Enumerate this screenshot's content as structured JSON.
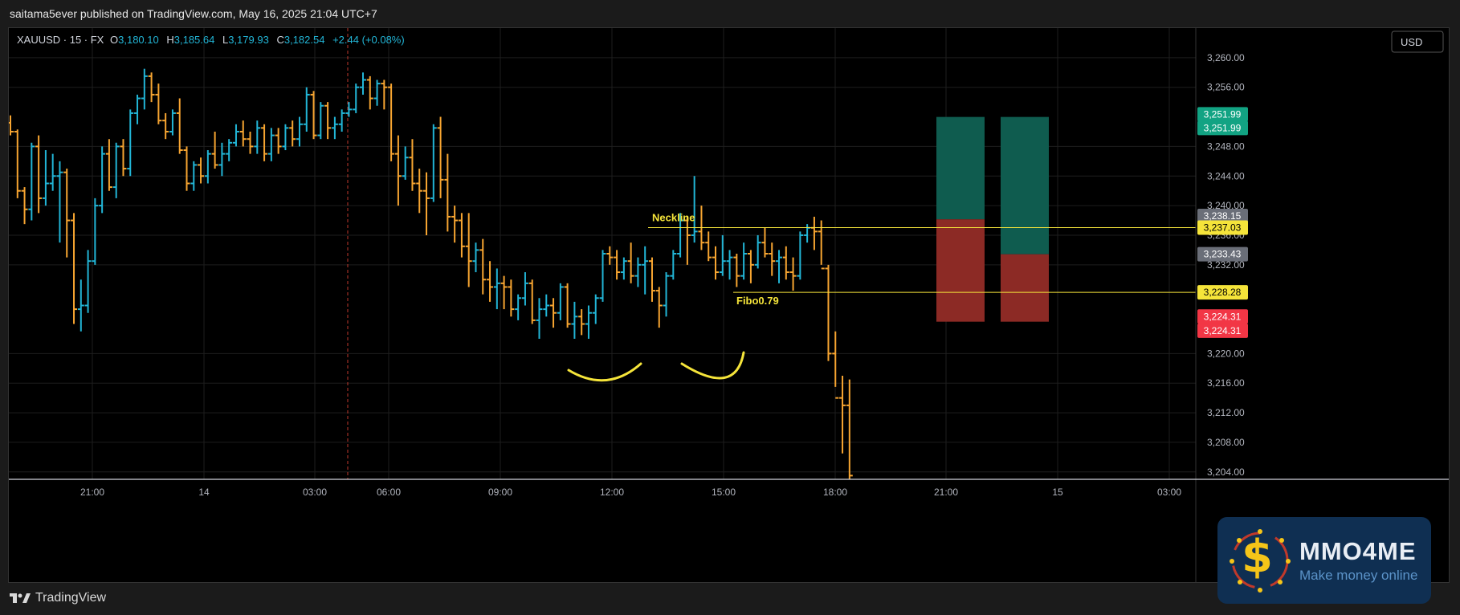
{
  "header": {
    "publisher_text": "saitama5ever published on TradingView.com, May 16, 2025 21:04 UTC+7"
  },
  "footer": {
    "logo_text": "TradingView"
  },
  "badge": {
    "brand": "MMO4ME",
    "tagline": "Make money online"
  },
  "colors": {
    "up": "#22b5d6",
    "down": "#f7a531",
    "annotation": "#f5e43a",
    "profit": "#0f5c4f",
    "loss": "#8c2a25"
  },
  "chart_data": {
    "type": "ohlc",
    "symbol_line": {
      "symbol": "XAUUSD · 15 · FX",
      "open_label": "O",
      "open": "3,180.10",
      "high_label": "H",
      "high": "3,185.64",
      "low_label": "L",
      "low": "3,179.93",
      "close_label": "C",
      "close": "3,182.54",
      "change": "+2.44 (+0.08%)"
    },
    "currency": "USD",
    "ylim": [
      3203,
      3264
    ],
    "y_ticks": [
      "3,260.00",
      "3,256.00",
      "3,248.00",
      "3,244.00",
      "3,240.00",
      "3,236.00",
      "3,232.00",
      "3,220.00",
      "3,216.00",
      "3,212.00",
      "3,208.00",
      "3,204.00"
    ],
    "x_ticks": [
      "21:00",
      "14",
      "03:00",
      "06:00",
      "09:00",
      "12:00",
      "15:00",
      "18:00",
      "21:00",
      "15",
      "03:00"
    ],
    "price_labels": [
      {
        "text": "3,251.99",
        "value": 3252.35,
        "color": "#12a383"
      },
      {
        "text": "3,251.99",
        "value": 3250.5,
        "color": "#12a383"
      },
      {
        "text": "3,238.15",
        "value": 3238.6,
        "color": "#6a6e78"
      },
      {
        "text": "3,237.03",
        "value": 3237.03,
        "color": "#f5e43a"
      },
      {
        "text": "3,233.43",
        "value": 3233.43,
        "color": "#6a6e78"
      },
      {
        "text": "3,228.28",
        "value": 3228.28,
        "color": "#f5e43a"
      },
      {
        "text": "3,224.31",
        "value": 3225.0,
        "color": "#f23645"
      },
      {
        "text": "3,224.31",
        "value": 3223.1,
        "color": "#f23645"
      }
    ],
    "annotations": [
      {
        "label": "Neckline",
        "value": 3237.03
      },
      {
        "label": "Fibo0.79",
        "value": 3228.28
      }
    ],
    "positions": [
      {
        "top": 3251.99,
        "entry": 3238.15,
        "stop": 3224.31
      },
      {
        "top": 3251.99,
        "entry": 3233.43,
        "stop": 3224.31
      }
    ],
    "bars": [
      [
        3251.2,
        3252.2,
        3249.5,
        3250.0
      ],
      [
        3250.0,
        3250.3,
        3241.0,
        3242.0
      ],
      [
        3242.0,
        3242.5,
        3237.5,
        3239.5
      ],
      [
        3239.5,
        3248.5,
        3238.0,
        3248.0
      ],
      [
        3248.0,
        3249.5,
        3239.0,
        3241.0
      ],
      [
        3241.0,
        3247.5,
        3240.0,
        3243.0
      ],
      [
        3243.0,
        3247.0,
        3242.0,
        3244.0
      ],
      [
        3244.0,
        3246.0,
        3235.0,
        3244.5
      ],
      [
        3244.5,
        3245.0,
        3233.0,
        3238.0
      ],
      [
        3238.0,
        3239.0,
        3224.0,
        3226.0
      ],
      [
        3226.0,
        3230.0,
        3223.0,
        3226.5
      ],
      [
        3226.5,
        3234.0,
        3225.5,
        3232.5
      ],
      [
        3232.5,
        3241.0,
        3232.0,
        3240.0
      ],
      [
        3240.0,
        3248.0,
        3239.0,
        3247.0
      ],
      [
        3247.0,
        3249.0,
        3242.0,
        3242.5
      ],
      [
        3242.5,
        3248.5,
        3241.0,
        3248.0
      ],
      [
        3248.0,
        3249.0,
        3244.0,
        3245.0
      ],
      [
        3245.0,
        3253.0,
        3244.0,
        3252.5
      ],
      [
        3252.5,
        3255.0,
        3251.0,
        3254.5
      ],
      [
        3254.5,
        3258.5,
        3253.0,
        3257.5
      ],
      [
        3257.5,
        3258.0,
        3254.0,
        3255.0
      ],
      [
        3255.0,
        3256.5,
        3251.0,
        3251.5
      ],
      [
        3251.5,
        3252.5,
        3249.0,
        3250.0
      ],
      [
        3250.0,
        3253.0,
        3249.5,
        3252.5
      ],
      [
        3252.5,
        3254.5,
        3247.0,
        3247.5
      ],
      [
        3247.5,
        3248.0,
        3242.0,
        3243.0
      ],
      [
        3243.0,
        3246.0,
        3242.0,
        3245.5
      ],
      [
        3245.5,
        3246.5,
        3243.0,
        3244.0
      ],
      [
        3244.0,
        3247.5,
        3243.0,
        3247.0
      ],
      [
        3247.0,
        3250.0,
        3245.0,
        3245.5
      ],
      [
        3245.5,
        3248.5,
        3244.0,
        3247.0
      ],
      [
        3247.0,
        3249.0,
        3246.0,
        3248.5
      ],
      [
        3248.5,
        3251.0,
        3248.0,
        3250.0
      ],
      [
        3250.0,
        3251.5,
        3248.0,
        3249.0
      ],
      [
        3249.0,
        3250.0,
        3247.0,
        3248.0
      ],
      [
        3248.0,
        3251.5,
        3247.0,
        3250.5
      ],
      [
        3250.5,
        3251.0,
        3246.0,
        3247.0
      ],
      [
        3247.0,
        3250.5,
        3246.0,
        3249.5
      ],
      [
        3249.5,
        3250.5,
        3247.0,
        3248.0
      ],
      [
        3248.0,
        3251.0,
        3247.5,
        3250.5
      ],
      [
        3250.5,
        3251.5,
        3248.0,
        3249.0
      ],
      [
        3249.0,
        3252.0,
        3248.0,
        3251.0
      ],
      [
        3251.0,
        3256.0,
        3250.0,
        3255.0
      ],
      [
        3255.0,
        3255.5,
        3249.0,
        3249.5
      ],
      [
        3249.5,
        3254.0,
        3249.0,
        3253.5
      ],
      [
        3253.5,
        3254.0,
        3249.0,
        3250.5
      ],
      [
        3250.5,
        3252.0,
        3249.0,
        3251.0
      ],
      [
        3251.0,
        3253.0,
        3250.0,
        3252.5
      ],
      [
        3252.5,
        3254.0,
        3252.0,
        3253.0
      ],
      [
        3253.0,
        3256.5,
        3252.5,
        3256.0
      ],
      [
        3256.0,
        3258.0,
        3255.0,
        3257.0
      ],
      [
        3257.0,
        3257.5,
        3253.0,
        3254.5
      ],
      [
        3254.5,
        3257.0,
        3253.5,
        3256.5
      ],
      [
        3256.5,
        3257.0,
        3253.0,
        3256.0
      ],
      [
        3256.0,
        3256.5,
        3246.0,
        3247.0
      ],
      [
        3247.0,
        3249.5,
        3240.0,
        3244.0
      ],
      [
        3244.0,
        3248.0,
        3243.5,
        3246.5
      ],
      [
        3246.5,
        3249.0,
        3242.0,
        3243.0
      ],
      [
        3243.0,
        3245.0,
        3239.0,
        3242.0
      ],
      [
        3242.0,
        3244.5,
        3236.0,
        3241.0
      ],
      [
        3241.0,
        3251.0,
        3240.5,
        3250.5
      ],
      [
        3250.5,
        3252.0,
        3241.0,
        3243.5
      ],
      [
        3243.5,
        3247.0,
        3236.5,
        3238.5
      ],
      [
        3238.5,
        3240.0,
        3235.0,
        3238.0
      ],
      [
        3238.0,
        3239.0,
        3233.0,
        3234.5
      ],
      [
        3234.5,
        3239.0,
        3229.0,
        3232.5
      ],
      [
        3232.5,
        3235.0,
        3231.0,
        3234.0
      ],
      [
        3234.0,
        3235.5,
        3228.0,
        3230.0
      ],
      [
        3230.0,
        3232.5,
        3227.0,
        3229.0
      ],
      [
        3229.0,
        3231.5,
        3226.0,
        3229.5
      ],
      [
        3229.5,
        3230.5,
        3226.0,
        3229.0
      ],
      [
        3229.0,
        3230.0,
        3225.0,
        3226.0
      ],
      [
        3226.0,
        3228.0,
        3224.5,
        3227.5
      ],
      [
        3227.5,
        3231.0,
        3226.5,
        3229.5
      ],
      [
        3229.5,
        3230.0,
        3224.0,
        3224.5
      ],
      [
        3224.5,
        3227.5,
        3222.0,
        3226.0
      ],
      [
        3226.0,
        3228.0,
        3225.0,
        3226.5
      ],
      [
        3226.5,
        3227.5,
        3223.5,
        3225.5
      ],
      [
        3225.5,
        3229.5,
        3224.5,
        3229.0
      ],
      [
        3229.0,
        3229.5,
        3223.5,
        3224.0
      ],
      [
        3224.0,
        3227.0,
        3222.0,
        3225.0
      ],
      [
        3225.0,
        3226.0,
        3222.5,
        3224.0
      ],
      [
        3224.0,
        3226.5,
        3222.0,
        3225.5
      ],
      [
        3225.5,
        3228.0,
        3224.0,
        3227.5
      ],
      [
        3227.5,
        3234.0,
        3227.0,
        3233.5
      ],
      [
        3233.5,
        3234.5,
        3232.0,
        3233.0
      ],
      [
        3233.0,
        3234.0,
        3230.0,
        3231.0
      ],
      [
        3231.0,
        3233.0,
        3230.0,
        3232.5
      ],
      [
        3232.5,
        3235.0,
        3229.5,
        3230.5
      ],
      [
        3230.5,
        3233.0,
        3229.0,
        3232.0
      ],
      [
        3232.0,
        3234.5,
        3228.0,
        3232.5
      ],
      [
        3232.5,
        3233.0,
        3227.0,
        3228.5
      ],
      [
        3228.5,
        3229.0,
        3223.5,
        3226.5
      ],
      [
        3226.5,
        3231.0,
        3225.0,
        3230.5
      ],
      [
        3230.5,
        3234.0,
        3230.0,
        3233.5
      ],
      [
        3233.5,
        3239.0,
        3233.0,
        3238.0
      ],
      [
        3238.0,
        3238.5,
        3232.0,
        3236.0
      ],
      [
        3236.0,
        3244.0,
        3235.0,
        3236.5
      ],
      [
        3236.5,
        3240.0,
        3234.0,
        3235.0
      ],
      [
        3235.0,
        3236.5,
        3232.5,
        3233.0
      ],
      [
        3233.0,
        3234.5,
        3230.0,
        3231.0
      ],
      [
        3231.0,
        3236.0,
        3230.5,
        3232.5
      ],
      [
        3232.5,
        3234.0,
        3230.0,
        3233.0
      ],
      [
        3233.0,
        3233.5,
        3229.0,
        3230.5
      ],
      [
        3230.5,
        3235.0,
        3230.0,
        3233.5
      ],
      [
        3233.5,
        3234.0,
        3229.5,
        3232.0
      ],
      [
        3232.0,
        3236.0,
        3231.5,
        3235.0
      ],
      [
        3235.0,
        3237.0,
        3233.0,
        3233.5
      ],
      [
        3233.5,
        3235.0,
        3230.5,
        3232.5
      ],
      [
        3232.5,
        3234.0,
        3229.5,
        3233.0
      ],
      [
        3233.0,
        3234.5,
        3230.0,
        3231.0
      ],
      [
        3231.0,
        3233.0,
        3228.5,
        3230.5
      ],
      [
        3230.5,
        3236.5,
        3230.0,
        3236.0
      ],
      [
        3236.0,
        3237.5,
        3235.0,
        3237.0
      ],
      [
        3237.0,
        3238.5,
        3234.0,
        3236.5
      ],
      [
        3236.5,
        3238.0,
        3232.0,
        3231.5
      ],
      [
        3231.5,
        3232.0,
        3219.0,
        3220.0
      ],
      [
        3220.0,
        3223.0,
        3215.5,
        3214.0
      ],
      [
        3214.0,
        3217.0,
        3206.5,
        3213.0
      ],
      [
        3213.0,
        3216.5,
        3203.0,
        3203.5
      ]
    ]
  }
}
